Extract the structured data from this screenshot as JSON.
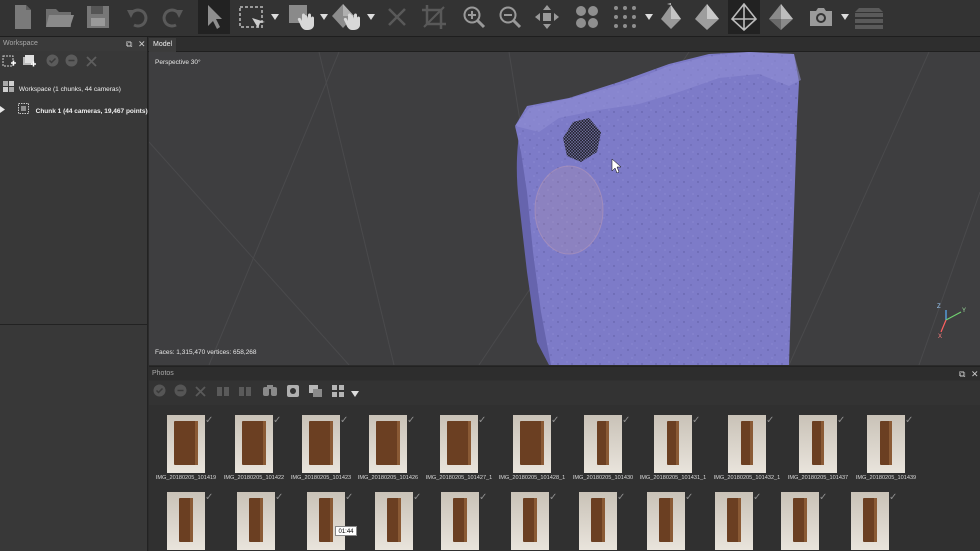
{
  "workspace": {
    "title": "Workspace",
    "tree": [
      {
        "label": "Workspace (1 chunks, 44 cameras)"
      },
      {
        "label": "Chunk 1 (44 cameras, 19,467 points)"
      }
    ]
  },
  "model": {
    "tab": "Model",
    "perspective": "Perspective 30°",
    "stats": "Faces: 1,315,470 vertices: 658,268",
    "axes": {
      "x": "X",
      "y": "Y",
      "z": "Z"
    }
  },
  "photos": {
    "title": "Photos",
    "row1": [
      "IMG_20180205_101419",
      "IMG_20180205_101422",
      "IMG_20180205_101423",
      "IMG_20180205_101426",
      "IMG_20180205_101427_1",
      "IMG_20180205_101428_1",
      "IMG_20180205_101430",
      "IMG_20180205_101431_1",
      "IMG_20180205_101432_1",
      "IMG_20180205_101437",
      "IMG_20180205_101439"
    ],
    "row2_count": 11
  },
  "timestamp": "01:44",
  "colors": {
    "mesh": "#7d7bc8",
    "mesh_dark": "#6664ad",
    "viewport": "#3e3e40"
  }
}
